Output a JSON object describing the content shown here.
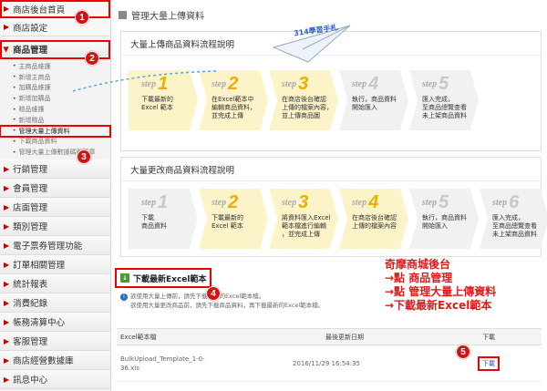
{
  "sidebar": {
    "store_home": "商店後台首頁",
    "store_settings": "商店設定",
    "product_mgmt": "商品管理",
    "product_subitems": [
      "主商品維護",
      "新增主商品",
      "加購品維護",
      "新增加購品",
      "贈品維護",
      "新增贈品",
      "管理大量上傳資料",
      "下載商品資料",
      "管理大量上傳數據碼與簽章"
    ],
    "sections": [
      "行銷管理",
      "會員管理",
      "店面管理",
      "類別管理",
      "電子票券管理功能",
      "訂單相關管理",
      "統計報表",
      "消費紀錄",
      "帳務清算中心",
      "客服管理",
      "商店經營數據庫",
      "訊息中心"
    ]
  },
  "page_title": "管理大量上傳資料",
  "panel1": {
    "title": "大量上傳商品資料流程說明",
    "steps": [
      {
        "label": "step",
        "num": "1",
        "text": "下載最新的\nExcel 範本"
      },
      {
        "label": "step",
        "num": "2",
        "text": "在Excel範本中\n編輯商品資料，\n並完成上傳"
      },
      {
        "label": "step",
        "num": "3",
        "text": "在商店後台確認\n上傳的檔案內容，\n並上傳商品圖"
      },
      {
        "label": "step",
        "num": "4",
        "text": "執行，商品資料\n開始匯入"
      },
      {
        "label": "step",
        "num": "5",
        "text": "匯入完成，\n至商品總覽查看\n未上架商品資料"
      }
    ]
  },
  "panel2": {
    "title": "大量更改商品資料流程說明",
    "steps": [
      {
        "label": "step",
        "num": "1",
        "text": "下載\n商品資料"
      },
      {
        "label": "step",
        "num": "2",
        "text": "下載最新的\nExcel 範本"
      },
      {
        "label": "step",
        "num": "3",
        "text": "將資料匯入Excel\n範本檔進行編輯\n，並完成上傳"
      },
      {
        "label": "step",
        "num": "4",
        "text": "在商店後台確認\n上傳的檔案內容"
      },
      {
        "label": "step",
        "num": "5",
        "text": "執行，商品資料\n開始匯入"
      },
      {
        "label": "step",
        "num": "6",
        "text": "匯入完成，\n至商品總覽查看\n未上架商品資料"
      }
    ]
  },
  "download": {
    "title": "下載最新Excel範本",
    "info1": "欲使用大量上傳前，請先下載最新的Excel範本檔。",
    "info2": "欲使用大量更改商品前，請先下載商品資料，再下載最新的Excel範本檔。",
    "col_template": "Excel範本檔",
    "col_updated": "最後更新日期",
    "col_download": "下載",
    "file_name": "BulkUpload_Template_1-0-36.xls",
    "updated": "2016/11/29 16:54:35",
    "download_label": "下載"
  },
  "annotation": [
    "奇摩商城後台",
    "→點 商品管理",
    "→點 管理大量上傳資料",
    "→下載最新Excel範本"
  ],
  "stamp": "314學習手札",
  "badges": [
    "1",
    "2",
    "3",
    "4",
    "5"
  ]
}
